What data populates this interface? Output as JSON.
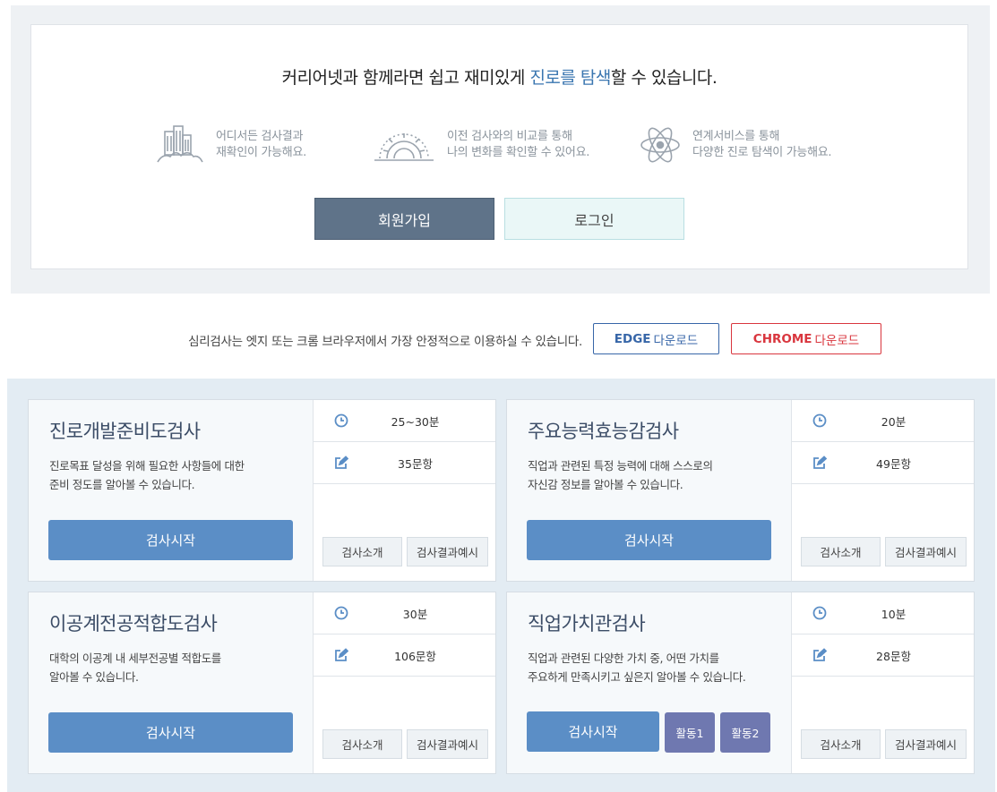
{
  "promo": {
    "headline_pre": "커리어넷과 함께라면 쉽고 재미있게 ",
    "headline_highlight": "진로를 탐색",
    "headline_post": "할 수 있습니다.",
    "features": [
      {
        "icon": "city-buildings-icon",
        "line1": "어디서든 검사결과",
        "line2": "재확인이 가능해요."
      },
      {
        "icon": "gear-icon",
        "line1": "이전 검사와의 비교를 통해",
        "line2": "나의 변화를 확인할 수 있어요."
      },
      {
        "icon": "atom-icon",
        "line1": "연계서비스를 통해",
        "line2": "다양한 진로 탐색이 가능해요."
      }
    ],
    "join_label": "회원가입",
    "login_label": "로그인"
  },
  "notice": {
    "text": "심리검사는 엣지 또는 크롬 브라우저에서 가장 안정적으로 이용하실 수 있습니다.",
    "edge_brand": "EDGE",
    "edge_suffix": "다운로드",
    "chrome_brand": "CHROME",
    "chrome_suffix": "다운로드"
  },
  "colors": {
    "accent": "#3a76b0",
    "start_button": "#5b8ec6",
    "activity_button": "#6f78b0",
    "edge": "#3766a8",
    "chrome": "#d9363e"
  },
  "tests": [
    {
      "title": "진로개발준비도검사",
      "desc1": "진로목표 달성을 위해 필요한 사항들에 대한",
      "desc2": "준비 정도를 알아볼 수 있습니다.",
      "time": "25~30분",
      "items": "35문항",
      "start": "검사시작",
      "intro": "검사소개",
      "example": "검사결과예시"
    },
    {
      "title": "주요능력효능감검사",
      "desc1": "직업과 관련된 특정 능력에 대해 스스로의",
      "desc2": "자신감 정보를 알아볼 수 있습니다.",
      "time": "20분",
      "items": "49문항",
      "start": "검사시작",
      "intro": "검사소개",
      "example": "검사결과예시"
    },
    {
      "title": "이공계전공적합도검사",
      "desc1": "대학의 이공계 내 세부전공별 적합도를",
      "desc2": "알아볼 수 있습니다.",
      "time": "30분",
      "items": "106문항",
      "start": "검사시작",
      "intro": "검사소개",
      "example": "검사결과예시"
    },
    {
      "title": "직업가치관검사",
      "desc1": "직업과 관련된 다양한 가치 중, 어떤 가치를",
      "desc2": "주요하게 만족시키고 싶은지 알아볼 수 있습니다.",
      "time": "10분",
      "items": "28문항",
      "start": "검사시작",
      "activity1": "활동1",
      "activity2": "활동2",
      "intro": "검사소개",
      "example": "검사결과예시"
    }
  ]
}
